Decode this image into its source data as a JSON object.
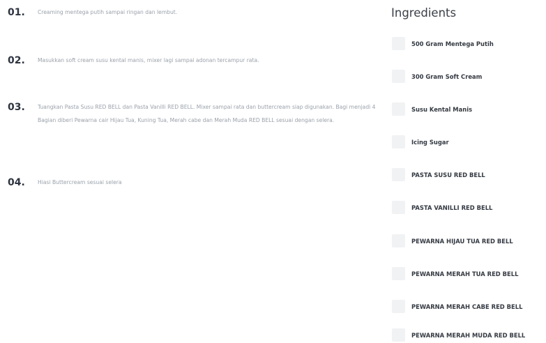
{
  "steps": [
    {
      "number": "01.",
      "text": "Creaming mentega putih sampai ringan dan lembut."
    },
    {
      "number": "02.",
      "text": "Masukkan soft cream susu kental manis, mixer lagi sampai adonan tercampur rata."
    },
    {
      "number": "03.",
      "text": "Tuangkan Pasta Susu RED BELL dan Pasta Vanilli RED BELL. Mixer sampai rata dan buttercream siap digunakan. Bagi menjadi 4 Bagian diberi Pewarna cair Hijau Tua, Kuning Tua, Merah cabe dan Merah Muda RED BELL sesuai dengan selera."
    },
    {
      "number": "04.",
      "text": "Hiasi Buttercream sesuai selera"
    }
  ],
  "ingredients": {
    "title": "Ingredients",
    "items": [
      "500 Gram Mentega Putih",
      "300 Gram Soft Cream",
      "Susu Kental Manis",
      "Icing Sugar",
      "PASTA SUSU RED BELL",
      "PASTA VANILLI RED BELL",
      "PEWARNA HIJAU TUA RED BELL",
      "PEWARNA MERAH TUA RED BELL",
      "PEWARNA MERAH CABE RED BELL",
      "PEWARNA MERAH MUDA RED BELL"
    ]
  }
}
